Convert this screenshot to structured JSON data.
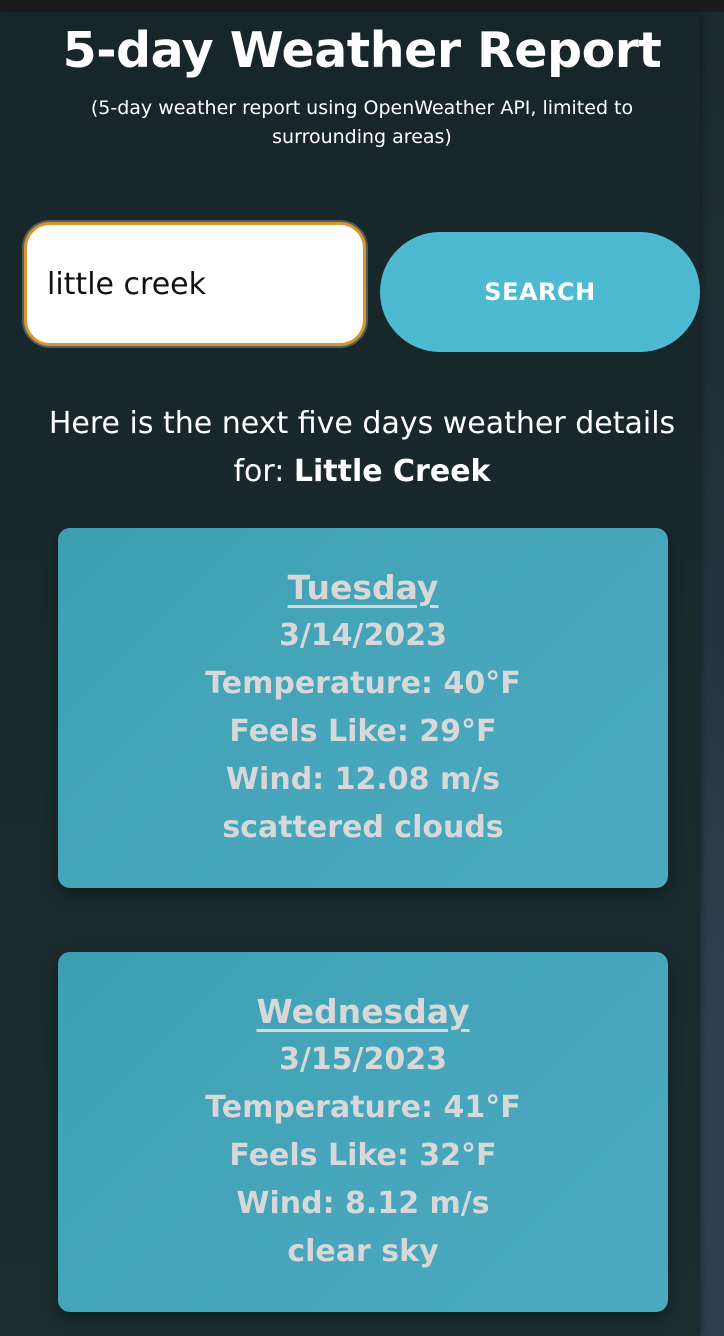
{
  "header": {
    "title": "5-day Weather Report",
    "subtitle": "(5-day weather report using OpenWeather API, limited to surrounding areas)"
  },
  "search": {
    "value": "little creek",
    "button_label": "SEARCH"
  },
  "intro": {
    "text": "Here is the next five days weather details for: ",
    "city": "Little Creek"
  },
  "forecast": [
    {
      "day": "Tuesday",
      "date": "3/14/2023",
      "temperature": "Temperature: 40°F",
      "feels_like": "Feels Like: 29°F",
      "wind": "Wind: 12.08 m/s",
      "description": "scattered clouds"
    },
    {
      "day": "Wednesday",
      "date": "3/15/2023",
      "temperature": "Temperature: 41°F",
      "feels_like": "Feels Like: 32°F",
      "wind": "Wind: 8.12 m/s",
      "description": "clear sky"
    }
  ],
  "colors": {
    "accent": "#4ebad2",
    "input_border": "#d9952e",
    "card": "#47a6bb",
    "background": "#1b2a2e"
  }
}
